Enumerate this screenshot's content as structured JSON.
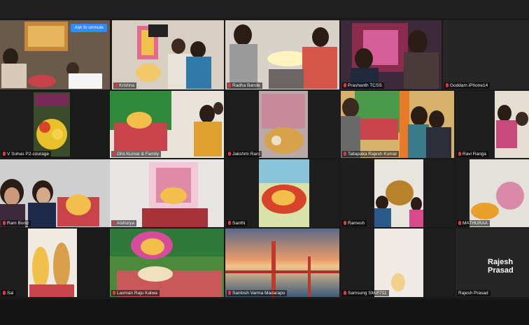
{
  "meeting": {
    "ask_unmute_label": "Ask to unmute",
    "tiles": [
      {
        "name": ""
      },
      {
        "name": "Krishna"
      },
      {
        "name": "Radha Bande"
      },
      {
        "name": "Prashanth TCSS"
      },
      {
        "name": "Goddam iPhone14"
      },
      {
        "name": "V Suhas P2-courage"
      },
      {
        "name": "Ghs Kumar & Family"
      },
      {
        "name": "Jakshmi Rani"
      },
      {
        "name": "Tallapaka Rajesh Kumar"
      },
      {
        "name": "Ravi Ranga"
      },
      {
        "name": "Ram Bond"
      },
      {
        "name": "Aishorya"
      },
      {
        "name": "Santhi"
      },
      {
        "name": "Ramesh"
      },
      {
        "name": "MATHURAA"
      },
      {
        "name": "Sai"
      },
      {
        "name": "Laxman Raju Kalwa"
      },
      {
        "name": "Santosh Varma Madarapu"
      },
      {
        "name": "Samsung SM-F711"
      },
      {
        "name": "Rajesh Prasad"
      }
    ],
    "large_name": "Rajesh Prasad"
  }
}
